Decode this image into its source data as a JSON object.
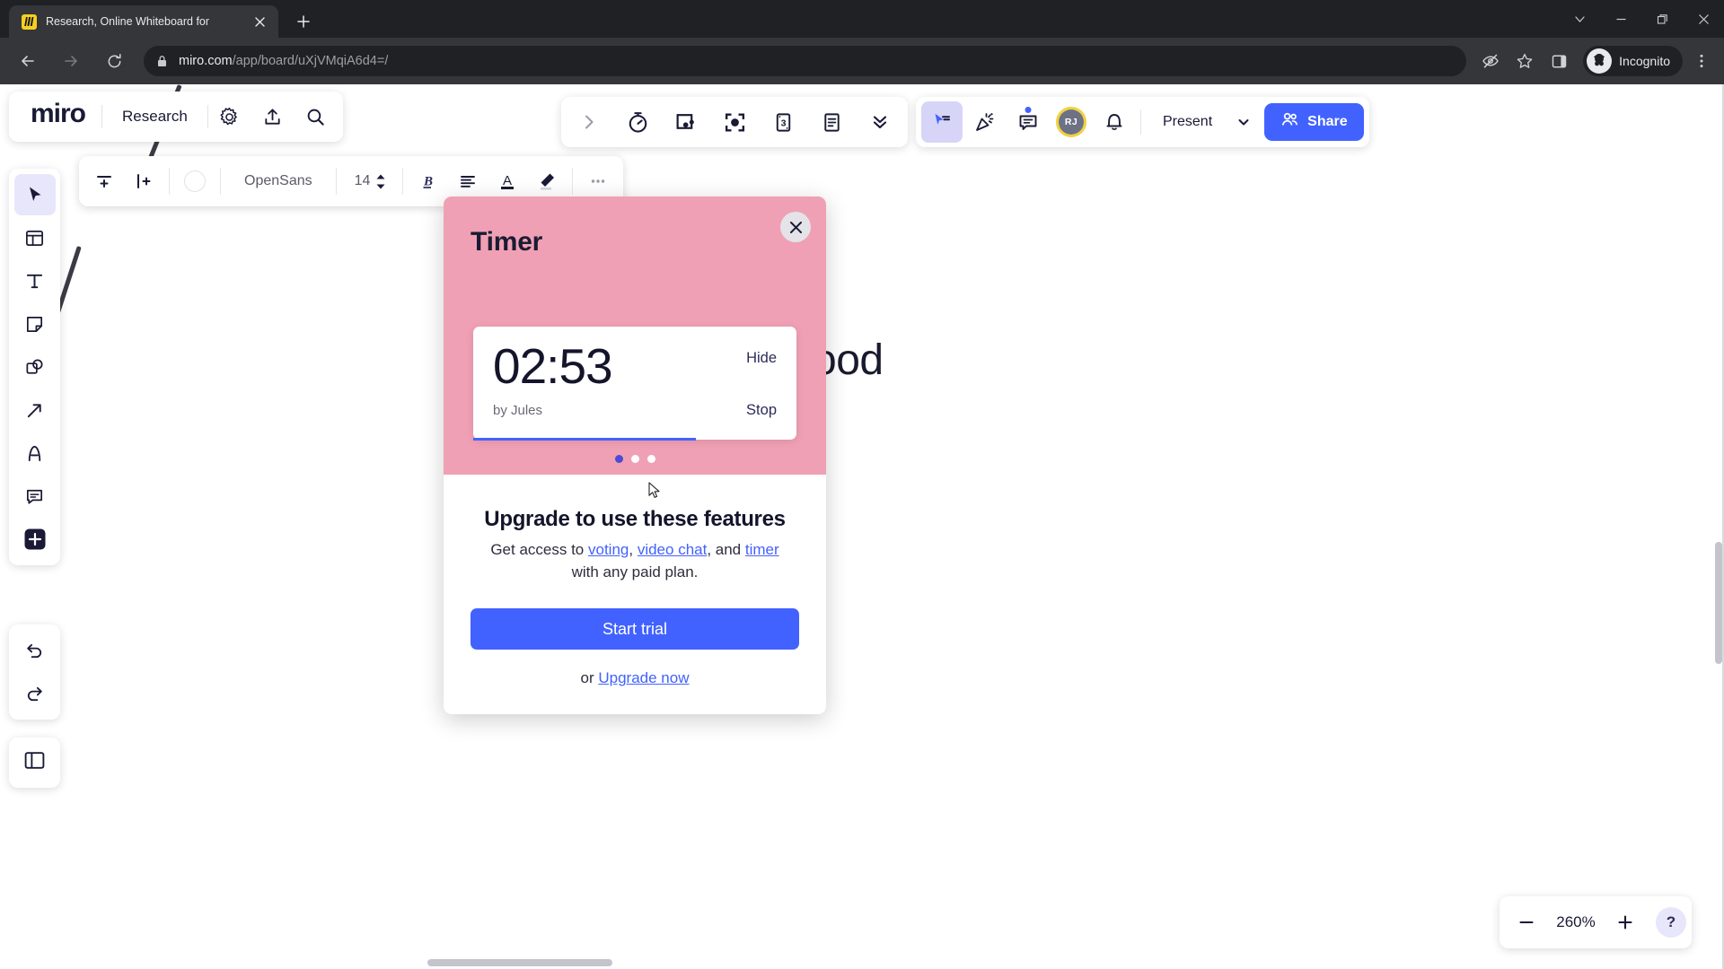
{
  "browser": {
    "tab": {
      "title": "Research, Online Whiteboard for",
      "favicon": "miro-favicon",
      "close": "×"
    },
    "newtab_label": "+",
    "window_controls": {
      "expand": "chevron-down-icon",
      "minimize": "minimize-icon",
      "maximize": "restore-icon",
      "close": "close-icon"
    },
    "nav": {
      "back": "back-arrow-icon",
      "forward": "forward-arrow-icon",
      "reload": "reload-icon"
    },
    "url": {
      "domain": "miro.com",
      "path": "/app/board/uXjVMqiA6d4=/",
      "lock": "lock-icon"
    },
    "omni_actions": [
      "tracking-protection-icon",
      "bookmark-star-icon",
      "side-panel-icon"
    ],
    "profile": {
      "label": "Incognito",
      "icon": "incognito-icon"
    },
    "menu": "three-dot-menu-icon"
  },
  "board": {
    "logo": "miro",
    "name": "Research",
    "icons": [
      "gear-icon",
      "upload-icon",
      "search-icon"
    ]
  },
  "center_toolbar": {
    "items": [
      {
        "name": "expand-chevron-icon",
        "label": ""
      },
      {
        "name": "timer-icon",
        "label": ""
      },
      {
        "name": "frame-icon",
        "label": ""
      },
      {
        "name": "focus-mode-icon",
        "label": ""
      },
      {
        "name": "card-three-icon",
        "label": "3"
      },
      {
        "name": "notes-icon",
        "label": ""
      },
      {
        "name": "chevrons-down-icon",
        "label": ""
      }
    ]
  },
  "right_toolbar": {
    "cursor_chat": "cursor-chat-icon",
    "reactions": "party-popper-icon",
    "comments": "comment-list-icon",
    "avatar_initials": "RJ",
    "notifications": "bell-icon",
    "present_label": "Present",
    "present_caret": "chevron-down-icon",
    "share_label": "Share",
    "share_icon": "people-icon"
  },
  "left_rail": {
    "items": [
      "cursor-select-icon",
      "templates-icon",
      "text-icon",
      "sticky-note-icon",
      "shapes-icon",
      "arrow-connector-icon",
      "pen-draw-icon",
      "comment-icon",
      "more-apps-icon"
    ],
    "undo": "undo-icon",
    "redo": "redo-icon",
    "panel_toggle": "side-panel-toggle-icon"
  },
  "format_toolbar": {
    "add_row_icon": "add-row-icon",
    "add_column_icon": "add-column-icon",
    "color_swatch": "fill-color-swatch",
    "font_family": "OpenSans",
    "font_size": "14",
    "bold_icon": "bold-icon",
    "align_icon": "align-left-icon",
    "text_color_icon": "text-color-icon",
    "highlight_icon": "highlighter-icon",
    "more_icon": "more-options-icon"
  },
  "canvas": {
    "text_snippet": "ood"
  },
  "timer_modal": {
    "title": "Timer",
    "close_icon": "close-icon",
    "header_color": "#f0a0b4",
    "accent_color": "#4262ff",
    "timer": {
      "value": "02:53",
      "hide_label": "Hide",
      "author": "by Jules",
      "stop_label": "Stop",
      "progress_percent": 69
    },
    "carousel": {
      "count": 3,
      "active_index": 0
    },
    "upgrade": {
      "title": "Upgrade to use these features",
      "text_prefix": "Get access to ",
      "link_voting": "voting",
      "comma": ", ",
      "link_video_chat": "video chat",
      "text_and": ", and ",
      "link_timer": "timer",
      "text_suffix": "with any paid plan.",
      "cta_label": "Start trial",
      "or_text": "or ",
      "upgrade_now_label": "Upgrade now"
    }
  },
  "zoom_controls": {
    "minus": "minus-icon",
    "level": "260%",
    "plus": "plus-icon",
    "help": "?"
  }
}
